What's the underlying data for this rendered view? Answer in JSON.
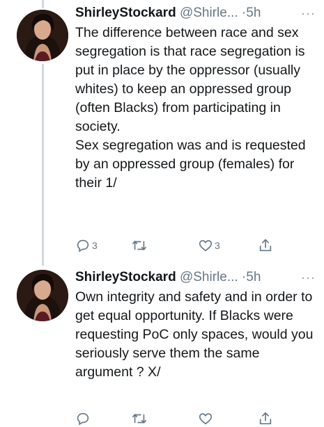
{
  "tweets": [
    {
      "author_name": "ShirleyStockard",
      "handle": "@Shirle...",
      "separator": "·",
      "time": "5h",
      "more": "···",
      "paragraphs": [
        "The difference between race and sex segregation is that race segregation is put in place by the oppressor (usually whites) to keep an oppressed group (often Blacks) from participating in society.",
        "Sex segregation was and is requested by an oppressed group (females) for their 1/"
      ],
      "actions": {
        "reply_icon": "reply-icon",
        "reply_count": "3",
        "retweet_icon": "retweet-icon",
        "like_icon": "heart-icon",
        "like_count": "3",
        "share_icon": "share-icon"
      }
    },
    {
      "author_name": "ShirleyStockard",
      "handle": "@Shirle...",
      "separator": "·",
      "time": "5h",
      "more": "···",
      "paragraphs": [
        "Own integrity and safety and in order to get equal opportunity. If Blacks were requesting PoC only spaces, would you seriously serve them the same argument ? X/"
      ],
      "actions": {
        "reply_icon": "reply-icon",
        "retweet_icon": "retweet-icon",
        "like_icon": "heart-icon",
        "share_icon": "share-icon"
      }
    }
  ],
  "colors": {
    "text": "#14171a",
    "muted": "#657786",
    "thread_line": "#cfd9de",
    "background": "#ffffff"
  }
}
